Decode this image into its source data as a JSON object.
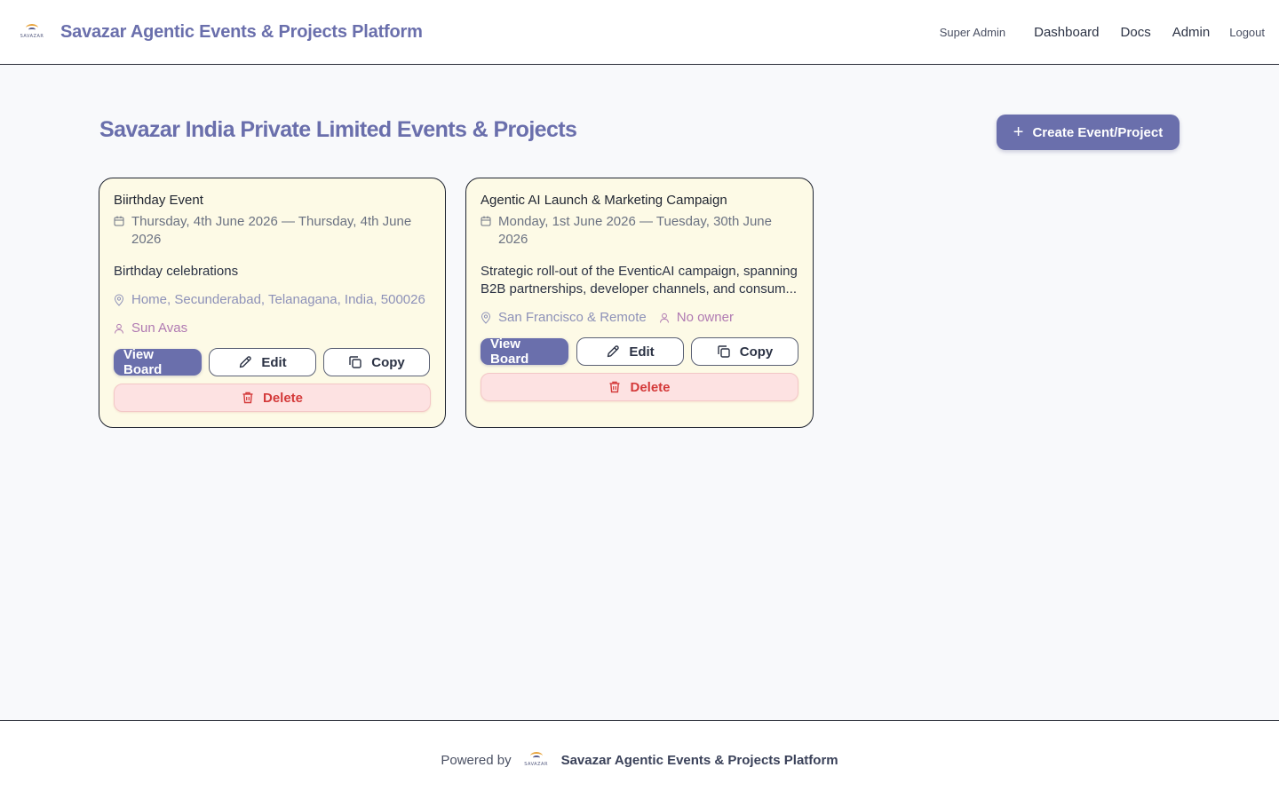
{
  "header": {
    "brand_title": "Savazar Agentic Events & Projects Platform",
    "logo_text": "SAVAZAR",
    "role": "Super Admin",
    "nav": [
      {
        "label": "Dashboard"
      },
      {
        "label": "Docs"
      },
      {
        "label": "Admin"
      }
    ],
    "logout": "Logout"
  },
  "main": {
    "title": "Savazar India Private Limited Events & Projects",
    "create_button": "Create Event/Project"
  },
  "cards": [
    {
      "title": "Biirthday Event",
      "date_line1": "Thursday, 4th June 2026 — Thursday, 4th June",
      "date_line2": "2026",
      "description": "Birthday celebrations",
      "location": "Home, Secunderabad, Telanagana, India, 500026",
      "owner": "Sun Avas",
      "view_board": "View Board",
      "edit": "Edit",
      "copy": "Copy",
      "delete": "Delete"
    },
    {
      "title": "Agentic AI Launch & Marketing Campaign",
      "date_line1": "Monday, 1st June 2026 — Tuesday, 30th June",
      "date_line2": "2026",
      "description": "Strategic roll-out of the EventicAI campaign, spanning B2B partnerships, developer channels, and consum...",
      "location": "San Francisco & Remote",
      "owner": "No owner",
      "view_board": "View Board",
      "edit": "Edit",
      "copy": "Copy",
      "delete": "Delete"
    }
  ],
  "footer": {
    "powered_by": "Powered by",
    "title": "Savazar Agentic Events & Projects Platform"
  },
  "colors": {
    "brand": "#6a6fac",
    "card_bg": "#fdfae6",
    "danger": "#d43a3a",
    "danger_bg": "#fde2e2",
    "owner": "#b07ab2"
  }
}
